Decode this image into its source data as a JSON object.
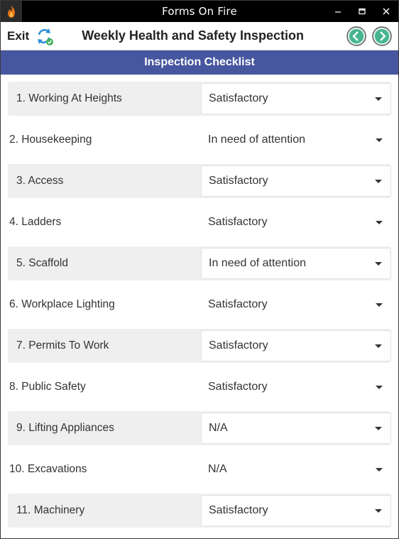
{
  "window": {
    "title": "Forms On Fire",
    "minimize_symbol": "—",
    "maximize_symbol": "▢",
    "close_symbol": "✕"
  },
  "header": {
    "exit_label": "Exit",
    "form_title": "Weekly Health and Safety Inspection"
  },
  "section": {
    "title": "Inspection Checklist"
  },
  "checklist": [
    {
      "label": "1. Working At Heights",
      "value": "Satisfactory"
    },
    {
      "label": "2. Housekeeping",
      "value": "In need of attention"
    },
    {
      "label": "3. Access",
      "value": "Satisfactory"
    },
    {
      "label": "4. Ladders",
      "value": "Satisfactory"
    },
    {
      "label": "5. Scaffold",
      "value": "In need of attention"
    },
    {
      "label": "6. Workplace Lighting",
      "value": "Satisfactory"
    },
    {
      "label": "7. Permits To Work",
      "value": "Satisfactory"
    },
    {
      "label": "8. Public Safety",
      "value": "Satisfactory"
    },
    {
      "label": "9. Lifting Appliances",
      "value": "N/A"
    },
    {
      "label": "10. Excavations",
      "value": "N/A"
    },
    {
      "label": "11. Machinery",
      "value": "Satisfactory"
    }
  ],
  "colors": {
    "section_bar": "#46569f",
    "nav_button": "#3fae8a",
    "sync_icon": "#2f8fd6"
  }
}
